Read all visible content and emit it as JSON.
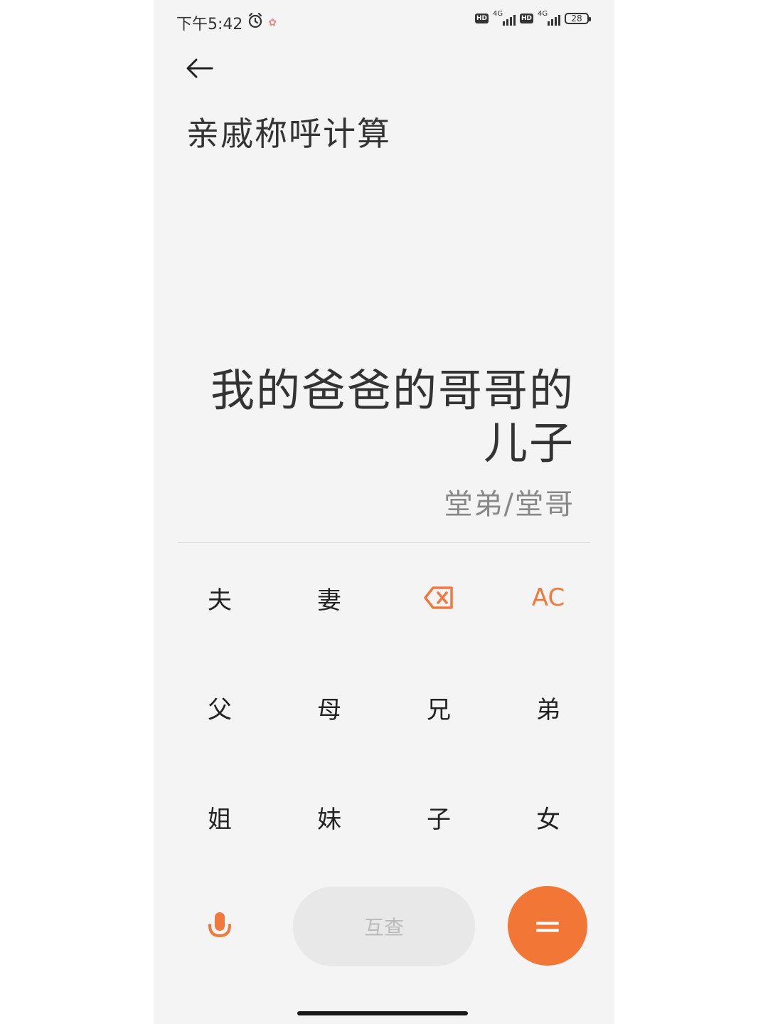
{
  "status_bar": {
    "time": "下午5:42",
    "network_1": "4G",
    "network_2": "4G",
    "hd_badge": "HD",
    "battery": "28"
  },
  "header": {
    "title": "亲戚称呼计算"
  },
  "display": {
    "expression": "我的爸爸的哥哥的儿子",
    "result": "堂弟/堂哥"
  },
  "keypad": {
    "row1": [
      "夫",
      "妻"
    ],
    "ac_label": "AC",
    "row2": [
      "父",
      "母",
      "兄",
      "弟"
    ],
    "row3": [
      "姐",
      "妹",
      "子",
      "女"
    ]
  },
  "bottom_bar": {
    "lookup_label": "互查",
    "equals_label": "="
  },
  "colors": {
    "accent": "#f27737",
    "background": "#f4f4f4",
    "text": "#333333"
  }
}
